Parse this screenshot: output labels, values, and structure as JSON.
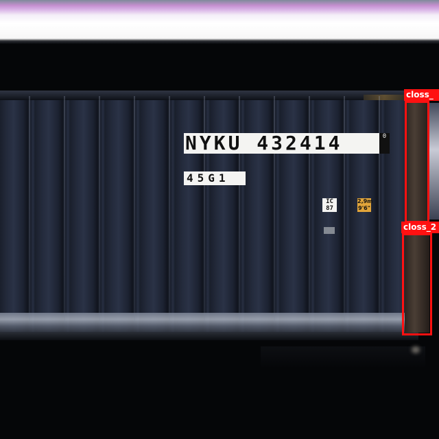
{
  "image": {
    "description_free": true
  },
  "container": {
    "number_text": "NYKU 432414",
    "check_digit_text": "0",
    "type_code_text": "45G1",
    "ic_label_text": "IC\n87",
    "height_label_text": "2,9m\n9'6\""
  },
  "detections": [
    {
      "label": "closs_",
      "color": "#ff1111"
    },
    {
      "label": "closs_2",
      "color": "#ff1111"
    }
  ]
}
